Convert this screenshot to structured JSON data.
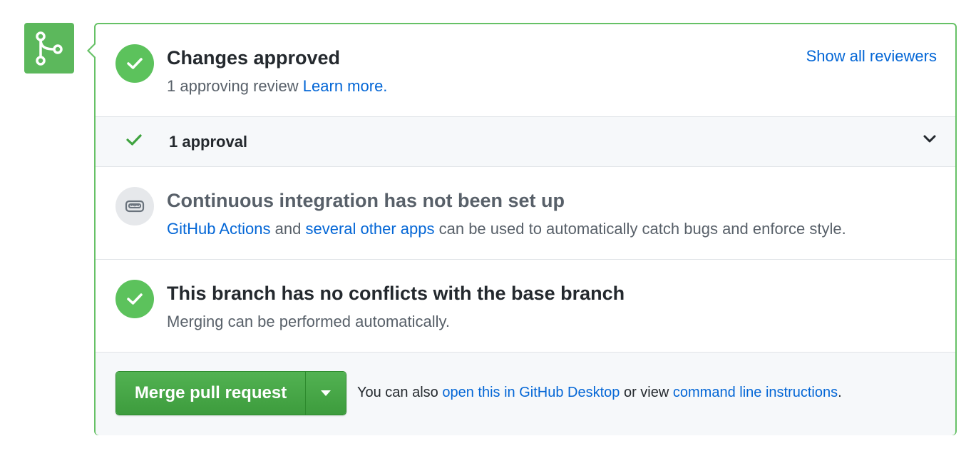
{
  "colors": {
    "success": "#5cc25c",
    "link": "#0366d6",
    "merge_button": "#3d9c3d",
    "panel_border": "#66c166"
  },
  "icons": {
    "badge": "git-merge-icon",
    "approved": "check-circle-icon",
    "ci": "robot-icon",
    "conflicts": "check-circle-icon",
    "approval_row": "check-icon",
    "expand": "chevron-down-icon",
    "merge_dropdown": "triangle-down-icon"
  },
  "review": {
    "title": "Changes approved",
    "description": "1 approving review",
    "learn_more": "Learn more.",
    "show_all_reviewers": "Show all reviewers"
  },
  "approvals": {
    "label": "1 approval"
  },
  "ci": {
    "title": "Continuous integration has not been set up",
    "link_actions": "GitHub Actions",
    "text_and": "and",
    "link_apps": "several other apps",
    "text_rest": "can be used to automatically catch bugs and enforce style."
  },
  "conflicts": {
    "title": "This branch has no conflicts with the base branch",
    "description": "Merging can be performed automatically."
  },
  "merge": {
    "button_label": "Merge pull request",
    "hint_prefix": "You can also",
    "link_desktop": "open this in GitHub Desktop",
    "hint_middle": "or view",
    "link_cli": "command line instructions",
    "hint_suffix": "."
  }
}
